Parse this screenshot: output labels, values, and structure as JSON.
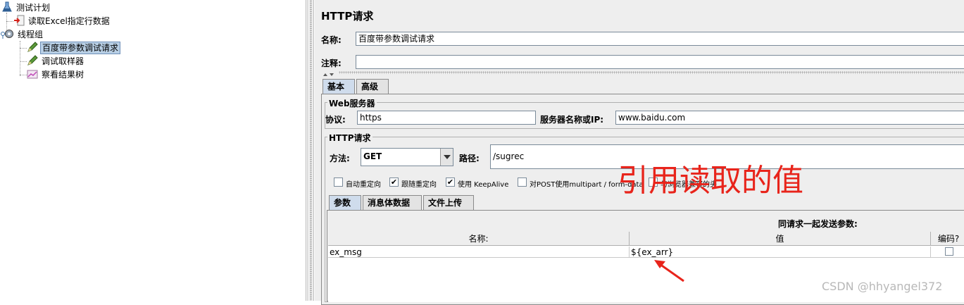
{
  "tree": {
    "items": [
      {
        "label": "测试计划",
        "icon": "test-plan-icon"
      },
      {
        "label": "读取Excel指定行数据",
        "icon": "preprocessor-icon"
      },
      {
        "label": "线程组",
        "icon": "gear-icon"
      },
      {
        "label": "百度带参数调试请求",
        "icon": "sampler-pen-icon",
        "selected": true
      },
      {
        "label": "调试取样器",
        "icon": "sampler-pen-icon"
      },
      {
        "label": "察看结果树",
        "icon": "listener-chart-icon"
      }
    ]
  },
  "panel": {
    "title": "HTTP请求",
    "name_label": "名称:",
    "name_value": "百度带参数调试请求",
    "comment_label": "注释:",
    "comment_value": ""
  },
  "top_tabs": [
    {
      "label": "基本",
      "active": true
    },
    {
      "label": "高级",
      "active": false
    }
  ],
  "web_server": {
    "group_title": "Web服务器",
    "protocol_label": "协议:",
    "protocol_value": "https",
    "server_label": "服务器名称或IP:",
    "server_value": "www.baidu.com"
  },
  "http_request": {
    "group_title": "HTTP请求",
    "method_label": "方法:",
    "method_value": "GET",
    "path_label": "路径:",
    "path_value": "/sugrec"
  },
  "checkboxes": [
    {
      "label": "自动重定向",
      "checked": false
    },
    {
      "label": "跟随重定向",
      "checked": true
    },
    {
      "label": "使用 KeepAlive",
      "checked": true
    },
    {
      "label": "对POST使用multipart / form-data",
      "checked": false
    },
    {
      "label": "与浏览器兼容的头",
      "checked": false
    }
  ],
  "sub_tabs": [
    {
      "label": "参数",
      "active": true
    },
    {
      "label": "消息体数据",
      "active": false
    },
    {
      "label": "文件上传",
      "active": false
    }
  ],
  "params": {
    "heading": "同请求一起发送参数:",
    "columns": [
      "名称:",
      "值",
      "编码?"
    ],
    "rows": [
      {
        "name": "ex_msg",
        "value": "${ex_arr}",
        "encode": false
      }
    ]
  },
  "annotation": {
    "text": "引用读取的值",
    "color": "#e8241b"
  },
  "watermark": "CSDN @hhyangel372"
}
